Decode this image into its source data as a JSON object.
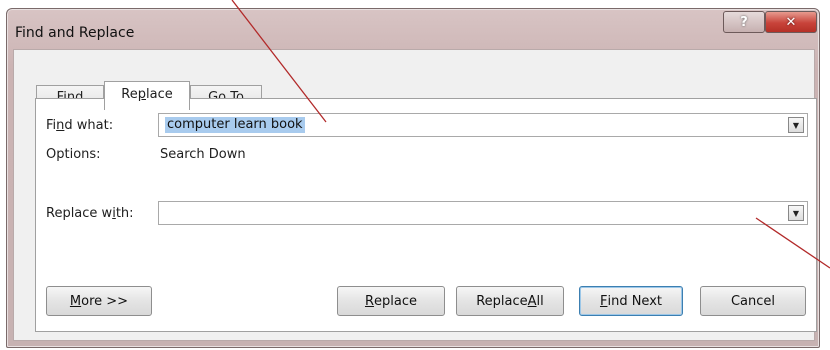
{
  "window": {
    "title": "Find and Replace",
    "help_label": "?",
    "close_label": "✕"
  },
  "tabs": [
    {
      "pre": "Fin",
      "accel": "d",
      "post": ""
    },
    {
      "pre": "Re",
      "accel": "p",
      "post": "lace"
    },
    {
      "pre": "",
      "accel": "G",
      "post": "o To"
    }
  ],
  "find": {
    "label_pre": "Fi",
    "label_accel": "n",
    "label_post": "d what:",
    "value": "computer learn book"
  },
  "options": {
    "label": "Options:",
    "value": "Search Down"
  },
  "replace": {
    "label_pre": "Replace w",
    "label_accel": "i",
    "label_post": "th:",
    "value": ""
  },
  "buttons": {
    "more": {
      "accel": "M",
      "post": "ore >>"
    },
    "replace": {
      "accel": "R",
      "post": "eplace"
    },
    "replace_all": {
      "pre": "Replace ",
      "accel": "A",
      "post": "ll"
    },
    "find_next": {
      "accel": "F",
      "post": "ind Next"
    },
    "cancel": "Cancel"
  },
  "colors": {
    "selection": "#a8cbee",
    "annotation": "#b22a2a"
  }
}
